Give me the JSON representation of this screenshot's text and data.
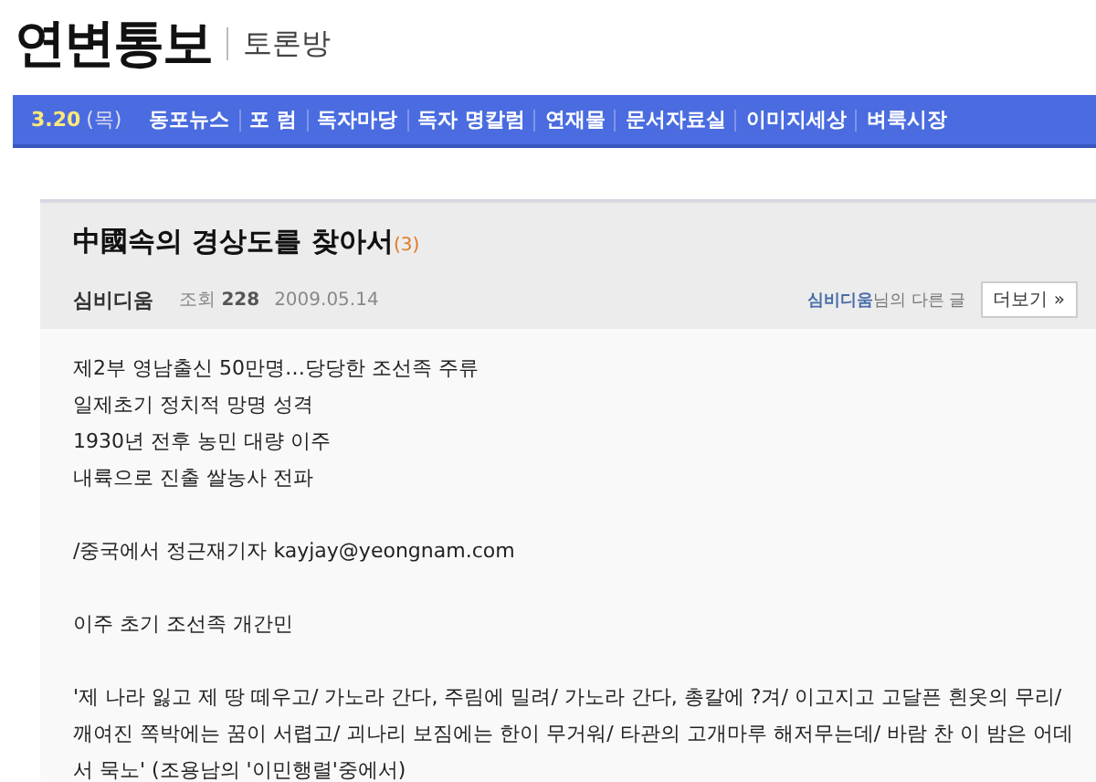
{
  "site": {
    "logo": "연변통보",
    "section": "토론방"
  },
  "nav": {
    "date": "3.20",
    "weekday": "(목)",
    "items": [
      "동포뉴스",
      "포 럼",
      "독자마당",
      "독자 명칼럼",
      "연재물",
      "문서자료실",
      "이미지세상",
      "벼룩시장"
    ]
  },
  "post": {
    "title": "中國속의 경상도를 찾아서",
    "comment_count": "(3)",
    "author": "심비디움",
    "views_label": "조회",
    "views": "228",
    "date": "2009.05.14",
    "other_posts_author": "심비디움",
    "other_posts_suffix": "님의 다른 글",
    "more_button": "더보기 »",
    "paragraphs": [
      {
        "lines": [
          "제2부 영남출신 50만명…당당한 조선족 주류",
          "일제초기 정치적 망명 성격",
          "1930년 전후 농민 대량 이주",
          "내륙으로 진출 쌀농사 전파"
        ]
      },
      {
        "lines": [
          "/중국에서 정근재기자 kayjay@yeongnam.com"
        ]
      },
      {
        "lines": [
          "이주 초기 조선족 개간민"
        ]
      },
      {
        "lines": [
          "'제 나라 잃고 제 땅 떼우고/ 가노라 간다, 주림에 밀려/ 가노라 간다, 총칼에 ?겨/ 이고지고 고달픈 흰옷의 무리/ 깨여진 쪽박에는 꿈이 서렵고/ 괴나리 보짐에는 한이 무거워/ 타관의 고개마루 해저무는데/ 바람 찬 이 밤은 어데서 묵노' (조용남의 '이민행렬'중에서)"
        ]
      }
    ]
  }
}
